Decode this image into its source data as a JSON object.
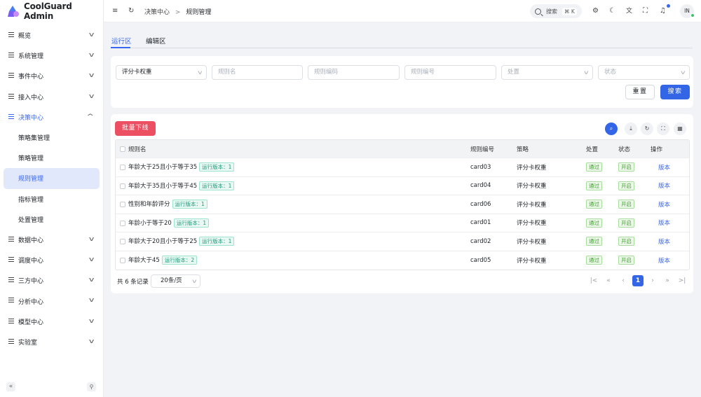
{
  "app": {
    "title": "CoolGuard Admin"
  },
  "sidebar": {
    "items": [
      {
        "label": "概览"
      },
      {
        "label": "系统管理"
      },
      {
        "label": "事件中心"
      },
      {
        "label": "接入中心"
      },
      {
        "label": "决策中心"
      },
      {
        "label": "数据中心"
      },
      {
        "label": "调度中心"
      },
      {
        "label": "三方中心"
      },
      {
        "label": "分析中心"
      },
      {
        "label": "模型中心"
      },
      {
        "label": "实验室"
      }
    ],
    "sub": [
      {
        "label": "策略集管理"
      },
      {
        "label": "策略管理"
      },
      {
        "label": "规则管理"
      },
      {
        "label": "指标管理"
      },
      {
        "label": "处置管理"
      }
    ]
  },
  "header": {
    "breadcrumb": [
      "决策中心",
      "规则管理"
    ],
    "breadcrumb_sep": ">",
    "search_label": "搜索",
    "search_shortcut": "⌘ K",
    "user_initials": "IN"
  },
  "tabs": [
    {
      "label": "运行区"
    },
    {
      "label": "编辑区"
    }
  ],
  "filter": {
    "scorecard_value": "评分卡权重",
    "rule_name_placeholder": "规则名",
    "rule_code_placeholder": "规则编码",
    "rule_no_placeholder": "规则编号",
    "disposal_placeholder": "处置",
    "status_placeholder": "状态",
    "reset_label": "重置",
    "search_label": "搜索"
  },
  "table": {
    "batch_offline_label": "批量下线",
    "columns": [
      "规则名",
      "规则编号",
      "策略",
      "处置",
      "状态",
      "操作"
    ],
    "rows": [
      {
        "name": "年龄大于25且小于等于35",
        "version": "运行版本：1",
        "code": "card03",
        "policy": "评分卡权重",
        "disposal": "通过",
        "status": "开启",
        "action": "版本"
      },
      {
        "name": "年龄大于35且小于等于45",
        "version": "运行版本：1",
        "code": "card04",
        "policy": "评分卡权重",
        "disposal": "通过",
        "status": "开启",
        "action": "版本"
      },
      {
        "name": "性别和年龄评分",
        "version": "运行版本：1",
        "code": "card06",
        "policy": "评分卡权重",
        "disposal": "通过",
        "status": "开启",
        "action": "版本"
      },
      {
        "name": "年龄小于等于20",
        "version": "运行版本：1",
        "code": "card01",
        "policy": "评分卡权重",
        "disposal": "通过",
        "status": "开启",
        "action": "版本"
      },
      {
        "name": "年龄大于20且小于等于25",
        "version": "运行版本：1",
        "code": "card02",
        "policy": "评分卡权重",
        "disposal": "通过",
        "status": "开启",
        "action": "版本"
      },
      {
        "name": "年龄大于45",
        "version": "运行版本：2",
        "code": "card05",
        "policy": "评分卡权重",
        "disposal": "通过",
        "status": "开启",
        "action": "版本"
      }
    ]
  },
  "pagination": {
    "total_text": "共 6 条记录",
    "page_size": "20条/页",
    "current_page": "1"
  },
  "colors": {
    "accent": "#3366e6",
    "danger": "#ec4f62"
  }
}
